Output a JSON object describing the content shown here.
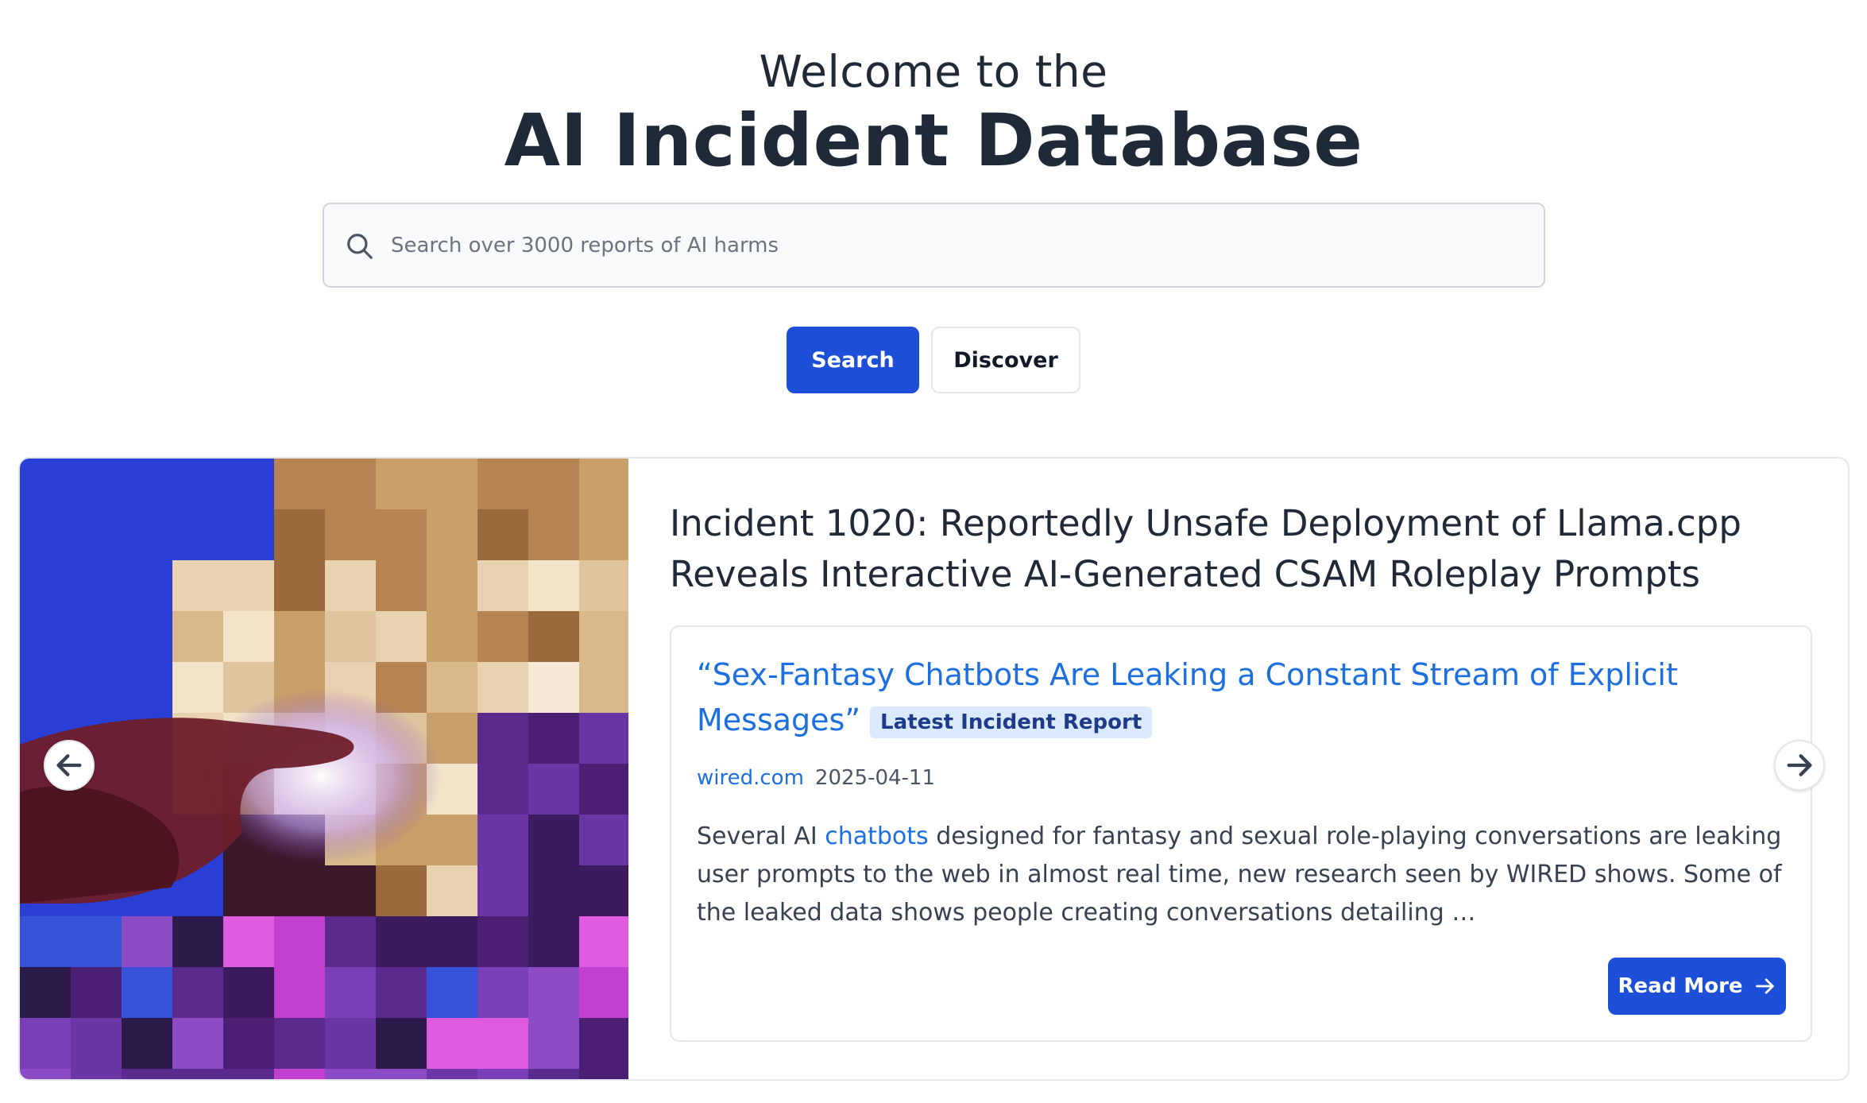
{
  "hero": {
    "welcome": "Welcome to the",
    "title": "AI Incident Database"
  },
  "search": {
    "placeholder": "Search over 3000 reports of AI harms",
    "search_label": "Search",
    "discover_label": "Discover"
  },
  "featured": {
    "incident_title": "Incident 1020: Reportedly Unsafe Deployment of Llama.cpp Reveals Interactive AI-Generated CSAM Roleplay Prompts",
    "report": {
      "title": "“Sex-Fantasy Chatbots Are Leaking a Constant Stream of Explicit Messages”",
      "badge": "Latest Incident Report",
      "source": "wired.com",
      "date": "2025-04-11",
      "snippet_before": "Several AI ",
      "snippet_link": "chatbots",
      "snippet_after": " designed for fantasy and sexual role-playing conversations are leaking user prompts to the web in almost real time, new research seen by WIRED shows. Some of the leaked data shows people creating conversations detailing …",
      "read_more_label": "Read More"
    }
  },
  "icons": {
    "search": "search-icon",
    "prev": "arrow-left-icon",
    "next": "arrow-right-icon",
    "read_more": "arrow-right-icon"
  },
  "colors": {
    "primary": "#1d4ed8",
    "link": "#1d6fe0",
    "badge_bg": "#dbeafe"
  }
}
